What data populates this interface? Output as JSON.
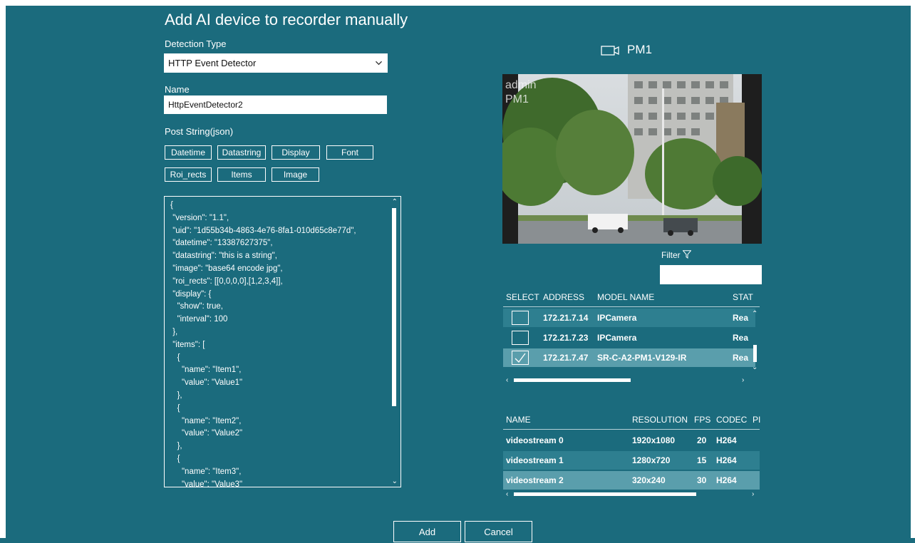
{
  "dialog": {
    "title": "Add AI device to recorder manually"
  },
  "detection": {
    "label": "Detection Type",
    "value": "HTTP Event Detector"
  },
  "name_field": {
    "label": "Name",
    "value": "HttpEventDetector2"
  },
  "post": {
    "label": "Post String(json)",
    "tags": [
      "Datetime",
      "Datastring",
      "Display",
      "Font",
      "Roi_rects",
      "Items",
      "Image"
    ],
    "lines": [
      "{",
      " \"version\": \"1.1\",",
      " \"uid\": \"1d55b34b-4863-4e76-8fa1-010d65c8e77d\",",
      " \"datetime\": \"13387627375\",",
      " \"datastring\": \"this is a string\",",
      " \"image\": \"base64 encode jpg\",",
      " \"roi_rects\": [[0,0,0,0],[1,2,3,4]],",
      " \"display\": {",
      "   \"show\": true,",
      "   \"interval\": 100",
      " },",
      " \"items\": [",
      "   {",
      "     \"name\": \"Item1\",",
      "     \"value\": \"Value1\"",
      "   },",
      "   {",
      "     \"name\": \"Item2\",",
      "     \"value\": \"Value2\"",
      "   },",
      "   {",
      "     \"name\": \"Item3\",",
      "     \"value\": \"Value3\""
    ]
  },
  "camera": {
    "name": "PM1",
    "overlay_user": "admin",
    "overlay_cam": "PM1",
    "filter_label": "Filter"
  },
  "devices": {
    "headers": [
      "SELECT",
      "ADDRESS",
      "MODEL NAME",
      "STAT"
    ],
    "rows": [
      {
        "address": "172.21.7.14",
        "model": "IPCamera",
        "status": "Rea",
        "checked": false
      },
      {
        "address": "172.21.7.23",
        "model": "IPCamera",
        "status": "Rea",
        "checked": false
      },
      {
        "address": "172.21.7.47",
        "model": "SR-C-A2-PM1-V129-IR",
        "status": "Rea",
        "checked": true
      }
    ]
  },
  "streams": {
    "headers": [
      "NAME",
      "RESOLUTION",
      "FPS",
      "CODEC",
      "PI"
    ],
    "rows": [
      {
        "name": "videostream 0",
        "resolution": "1920x1080",
        "fps": "20",
        "codec": "H264"
      },
      {
        "name": "videostream 1",
        "resolution": "1280x720",
        "fps": "15",
        "codec": "H264"
      },
      {
        "name": "videostream 2",
        "resolution": "320x240",
        "fps": "30",
        "codec": "H264"
      }
    ]
  },
  "actions": {
    "add": "Add",
    "cancel": "Cancel"
  },
  "colors": {
    "background": "#1b6b7d",
    "row_alt": "#2e7f90",
    "row_selected": "#5a9eac",
    "foreground": "#ffffff"
  }
}
